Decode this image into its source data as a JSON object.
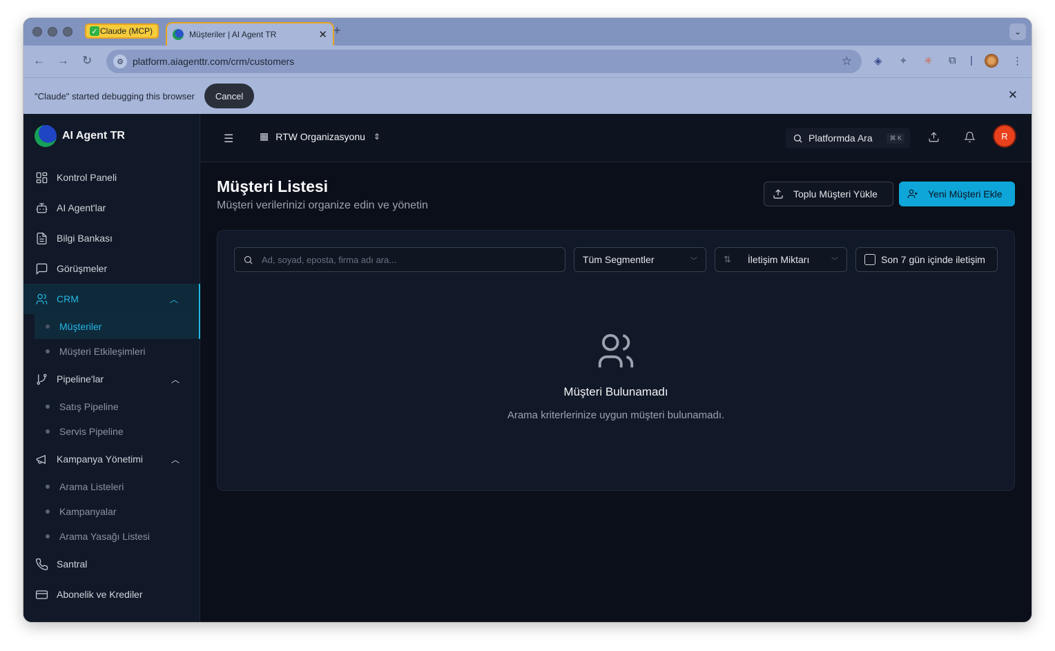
{
  "browser": {
    "tabs": [
      {
        "label": "Claude (MCP)"
      },
      {
        "label": "Müşteriler | AI Agent TR"
      }
    ],
    "new_tab": "+",
    "url": "platform.aiagenttr.com/crm/customers"
  },
  "debug_bar": {
    "message": "\"Claude\" started debugging this browser",
    "cancel": "Cancel"
  },
  "sidebar": {
    "brand": "AI Agent TR",
    "items": [
      {
        "label": "Kontrol Paneli"
      },
      {
        "label": "AI Agent'lar"
      },
      {
        "label": "Bilgi Bankası"
      },
      {
        "label": "Görüşmeler"
      },
      {
        "label": "CRM"
      },
      {
        "label": "Müşteriler"
      },
      {
        "label": "Müşteri Etkileşimleri"
      },
      {
        "label": "Pipeline'lar"
      },
      {
        "label": "Satış Pipeline"
      },
      {
        "label": "Servis Pipeline"
      },
      {
        "label": "Kampanya Yönetimi"
      },
      {
        "label": "Arama Listeleri"
      },
      {
        "label": "Kampanyalar"
      },
      {
        "label": "Arama Yasağı Listesi"
      },
      {
        "label": "Santral"
      },
      {
        "label": "Abonelik ve Krediler"
      }
    ]
  },
  "header": {
    "organization": "RTW Organizasyonu",
    "search_label": "Platformda Ara",
    "search_shortcut": "⌘ K",
    "avatar_initial": "R"
  },
  "main": {
    "title": "Müşteri Listesi",
    "subtitle": "Müşteri verilerinizi organize edin ve yönetin",
    "bulk_upload": "Toplu Müşteri Yükle",
    "new_customer": "Yeni Müşteri Ekle",
    "search_placeholder": "Ad, soyad, eposta, firma adı ara...",
    "segment_select": "Tüm Segmentler",
    "sort_select": "İletişim Miktarı",
    "recent_contact_checkbox": "Son 7 gün içinde iletişim",
    "empty_title": "Müşteri Bulunamadı",
    "empty_message": "Arama kriterlerinize uygun müşteri bulunamadı."
  },
  "colors": {
    "accent": "#22b8e6",
    "primary_button": "#0ea5d9",
    "avatar": "#e9411d"
  }
}
